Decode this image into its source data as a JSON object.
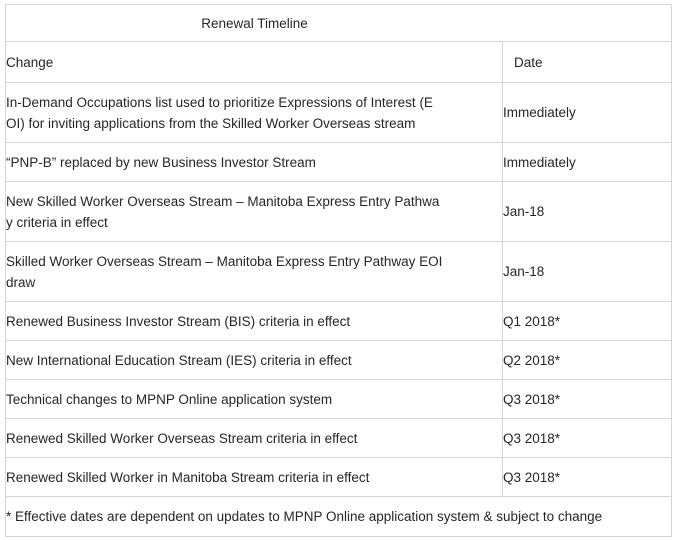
{
  "table": {
    "title": "Renewal Timeline",
    "columns": [
      {
        "key": "change",
        "header": "Change"
      },
      {
        "key": "date",
        "header": "Date"
      }
    ],
    "rows": [
      {
        "change": "In-Demand Occupations list used  to prioritize Expressions of Interest (EOI) for inviting applications from  the Skilled Worker Overseas stream",
        "change_line_1": "In-Demand Occupations list used  to prioritize Expressions of Interest (E",
        "change_line_2": "OI) for inviting applications from  the Skilled Worker Overseas stream",
        "date": "Immediately",
        "lines": 2
      },
      {
        "change": "“PNP-B” replaced by new Business  Investor Stream",
        "change_line_1": "“PNP-B” replaced by new Business  Investor Stream",
        "change_line_2": "",
        "date": "Immediately",
        "lines": 1
      },
      {
        "change": "New Skilled Worker Overseas  Stream – Manitoba Express Entry Pathway criteria in effect",
        "change_line_1": "New Skilled Worker Overseas  Stream – Manitoba Express Entry Pathwa",
        "change_line_2": "y criteria in effect",
        "date": "Jan-18",
        "lines": 2
      },
      {
        "change": "Skilled Worker Overseas Stream –  Manitoba Express Entry Pathway EOI draw",
        "change_line_1": "Skilled Worker Overseas Stream –  Manitoba Express Entry Pathway EOI",
        "change_line_2": "draw",
        "date": "Jan-18",
        "lines": 2
      },
      {
        "change": "Renewed Business Investor Stream  (BIS) criteria in effect",
        "change_line_1": "Renewed Business Investor Stream  (BIS) criteria in effect",
        "change_line_2": "",
        "date": "Q1 2018*",
        "lines": 1
      },
      {
        "change": "New International Education  Stream (IES) criteria in effect",
        "change_line_1": "New International Education  Stream (IES) criteria in effect",
        "change_line_2": "",
        "date": "Q2 2018*",
        "lines": 1
      },
      {
        "change": "Technical changes to MPNP Online  application system",
        "change_line_1": "Technical changes to MPNP Online  application system",
        "change_line_2": "",
        "date": "Q3 2018*",
        "lines": 1
      },
      {
        "change": "Renewed Skilled Worker Overseas  Stream criteria in effect",
        "change_line_1": "Renewed Skilled Worker Overseas  Stream criteria in effect",
        "change_line_2": "",
        "date": "Q3 2018*",
        "lines": 1
      },
      {
        "change": "Renewed Skilled Worker in  Manitoba Stream criteria in effect",
        "change_line_1": "Renewed Skilled Worker in  Manitoba Stream criteria in effect",
        "change_line_2": "",
        "date": "Q3 2018*",
        "lines": 1
      }
    ],
    "footnote": "* Effective dates are dependent on updates to MPNP Online application system & subject to change"
  },
  "colors": {
    "text": "#262626",
    "grid_line": "#d5d5d5",
    "outer_border": "#1a1a1a",
    "background": "#ffffff"
  }
}
